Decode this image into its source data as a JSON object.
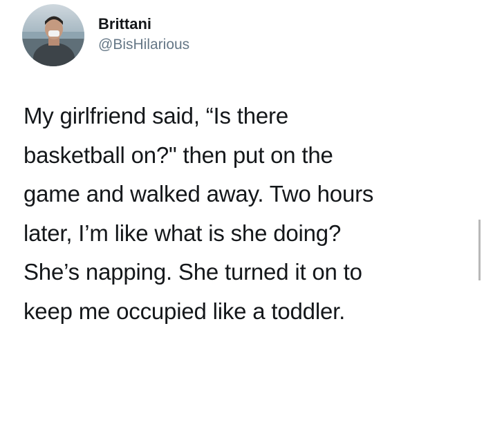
{
  "tweet": {
    "author": {
      "display_name": "Brittani",
      "handle": "@BisHilarious"
    },
    "text_lines": [
      "My girlfriend said, “Is there",
      "basketball on?\" then put on the",
      "game and walked away. Two hours",
      "later, I’m like what is she doing?",
      "She’s napping. She turned it on to",
      "keep me occupied like a toddler."
    ]
  },
  "colors": {
    "text": "#14171a",
    "secondary_text": "#657786",
    "background": "#ffffff"
  },
  "icons": {
    "avatar": "profile-photo"
  }
}
